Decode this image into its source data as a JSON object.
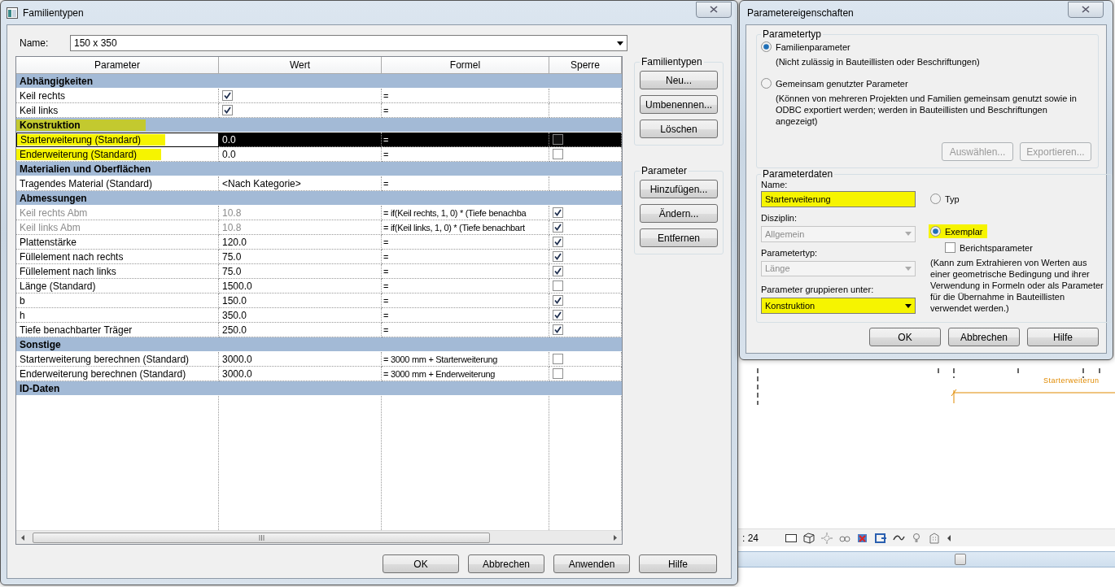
{
  "family_types_dialog": {
    "title": "Familientypen",
    "name_label": "Name:",
    "name_value": "150 x 350",
    "columns": [
      "Parameter",
      "Wert",
      "Formel",
      "Sperre"
    ],
    "groups": [
      {
        "title": "Abhängigkeiten",
        "highlighted": false,
        "rows": [
          {
            "parameter": "Keil rechts",
            "kind": "checkbox",
            "checked": true,
            "formula": "=",
            "disabled": false,
            "selected": false,
            "highlighted": false
          },
          {
            "parameter": "Keil links",
            "kind": "checkbox",
            "checked": true,
            "formula": "=",
            "disabled": false,
            "selected": false,
            "highlighted": false
          }
        ]
      },
      {
        "title": "Konstruktion",
        "highlighted": true,
        "rows": [
          {
            "parameter": "Starterweiterung (Standard)",
            "kind": "text",
            "value": "0.0",
            "formula": "=",
            "locked": false,
            "disabled": false,
            "selected": true,
            "highlighted": true
          },
          {
            "parameter": "Enderweiterung (Standard)",
            "kind": "text",
            "value": "0.0",
            "formula": "=",
            "locked": false,
            "disabled": false,
            "selected": false,
            "highlighted": true
          }
        ]
      },
      {
        "title": "Materialien und Oberflächen",
        "highlighted": false,
        "rows": [
          {
            "parameter": "Tragendes Material (Standard)",
            "kind": "text",
            "value": "<Nach Kategorie>",
            "formula": "=",
            "disabled": false,
            "selected": false,
            "highlighted": false
          }
        ]
      },
      {
        "title": "Abmessungen",
        "highlighted": false,
        "rows": [
          {
            "parameter": "Keil rechts Abm",
            "kind": "text",
            "value": "10.8",
            "formula": "= if(Keil rechts, 1, 0) * (Tiefe benachba",
            "locked": true,
            "disabled": true,
            "selected": false,
            "highlighted": false
          },
          {
            "parameter": "Keil links Abm",
            "kind": "text",
            "value": "10.8",
            "formula": "= if(Keil links, 1, 0) * (Tiefe benachbart",
            "locked": true,
            "disabled": true,
            "selected": false,
            "highlighted": false
          },
          {
            "parameter": "Plattenstärke",
            "kind": "text",
            "value": "120.0",
            "formula": "=",
            "locked": true,
            "disabled": false,
            "selected": false,
            "highlighted": false
          },
          {
            "parameter": "Füllelement nach rechts",
            "kind": "text",
            "value": "75.0",
            "formula": "=",
            "locked": true,
            "disabled": false,
            "selected": false,
            "highlighted": false
          },
          {
            "parameter": "Füllelement nach links",
            "kind": "text",
            "value": "75.0",
            "formula": "=",
            "locked": true,
            "disabled": false,
            "selected": false,
            "highlighted": false
          },
          {
            "parameter": "Länge (Standard)",
            "kind": "text",
            "value": "1500.0",
            "formula": "=",
            "locked": false,
            "disabled": false,
            "selected": false,
            "highlighted": false
          },
          {
            "parameter": "b",
            "kind": "text",
            "value": "150.0",
            "formula": "=",
            "locked": true,
            "disabled": false,
            "selected": false,
            "highlighted": false
          },
          {
            "parameter": "h",
            "kind": "text",
            "value": "350.0",
            "formula": "=",
            "locked": true,
            "disabled": false,
            "selected": false,
            "highlighted": false
          },
          {
            "parameter": "Tiefe benachbarter Träger",
            "kind": "text",
            "value": "250.0",
            "formula": "=",
            "locked": true,
            "disabled": false,
            "selected": false,
            "highlighted": false
          }
        ]
      },
      {
        "title": "Sonstige",
        "highlighted": false,
        "rows": [
          {
            "parameter": "Starterweiterung berechnen (Standard)",
            "kind": "text",
            "value": "3000.0",
            "formula": "= 3000 mm + Starterweiterung",
            "locked": false,
            "disabled": false,
            "selected": false,
            "highlighted": false
          },
          {
            "parameter": "Enderweiterung berechnen (Standard)",
            "kind": "text",
            "value": "3000.0",
            "formula": "= 3000 mm + Enderweiterung",
            "locked": false,
            "disabled": false,
            "selected": false,
            "highlighted": false
          }
        ]
      },
      {
        "title": "ID-Daten",
        "highlighted": false
      }
    ],
    "side_groups": [
      {
        "title": "Familientypen",
        "buttons": [
          "Neu...",
          "Umbenennen...",
          "Löschen"
        ]
      },
      {
        "title": "Parameter",
        "buttons": [
          "Hinzufügen...",
          "Ändern...",
          "Entfernen"
        ]
      }
    ],
    "footer_buttons": [
      "OK",
      "Abbrechen",
      "Anwenden",
      "Hilfe"
    ]
  },
  "parameter_properties_dialog": {
    "title": "Parametereigenschaften",
    "type_group": {
      "title": "Parametertyp",
      "options": [
        {
          "label": "Familienparameter",
          "note": "(Nicht zulässig in Bauteillisten oder Beschriftungen)",
          "selected": true
        },
        {
          "label": "Gemeinsam genutzter Parameter",
          "note": "(Können von mehreren Projekten und Familien gemeinsam genutzt sowie in ODBC exportiert werden; werden in Bauteillisten und Beschriftungen angezeigt)",
          "selected": false
        }
      ],
      "buttons": [
        {
          "label": "Auswählen...",
          "disabled": true
        },
        {
          "label": "Exportieren...",
          "disabled": true
        }
      ]
    },
    "data_group": {
      "title": "Parameterdaten",
      "name_label": "Name:",
      "name_value": "Starterweiterung",
      "name_highlighted": true,
      "fields": [
        {
          "label": "Disziplin:",
          "value": "Allgemein",
          "disabled": true,
          "highlighted": false
        },
        {
          "label": "Parametertyp:",
          "value": "Länge",
          "disabled": true,
          "highlighted": false
        },
        {
          "label": "Parameter gruppieren unter:",
          "value": "Konstruktion",
          "disabled": false,
          "highlighted": true
        }
      ],
      "instance_options": [
        {
          "label": "Typ",
          "selected": false,
          "highlighted": false
        },
        {
          "label": "Exemplar",
          "selected": true,
          "highlighted": true
        }
      ],
      "report_checkbox": {
        "label": "Berichtsparameter",
        "checked": false
      },
      "note": "(Kann zum Extrahieren von Werten aus einer geometrische Bedingung und ihrer Verwendung in Formeln oder als Parameter für die Übernahme in Bauteillisten verwendet werden.)"
    },
    "buttons": [
      "OK",
      "Abbrechen",
      "Hilfe"
    ]
  },
  "drawing_area": {
    "dimension_label": "Starterweiterun",
    "scale": ": 24"
  }
}
